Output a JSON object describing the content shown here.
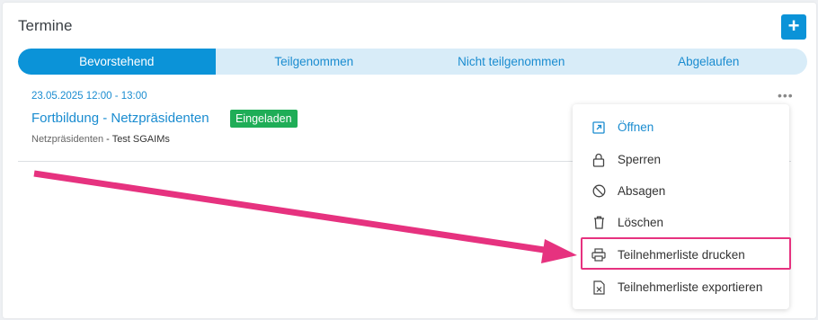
{
  "panel": {
    "title": "Termine",
    "add_label": "+"
  },
  "tabs": [
    {
      "label": "Bevorstehend",
      "active": true
    },
    {
      "label": "Teilgenommen",
      "active": false
    },
    {
      "label": "Nicht teilgenommen",
      "active": false
    },
    {
      "label": "Abgelaufen",
      "active": false
    }
  ],
  "event": {
    "datetime": "23.05.2025 12:00 - 13:00",
    "title": "Fortbildung - Netzpräsidenten",
    "status_badge": "Eingeladen",
    "group": "Netzpräsidenten",
    "separator": " - ",
    "course": "Test SGAIMs",
    "more_label": "•••"
  },
  "menu": {
    "items": [
      {
        "label": "Öffnen",
        "icon": "external-link-icon"
      },
      {
        "label": "Sperren",
        "icon": "lock-icon"
      },
      {
        "label": "Absagen",
        "icon": "cancel-icon"
      },
      {
        "label": "Löschen",
        "icon": "trash-icon"
      },
      {
        "label": "Teilnehmerliste drucken",
        "icon": "printer-icon"
      },
      {
        "label": "Teilnehmerliste exportieren",
        "icon": "excel-file-icon"
      }
    ]
  },
  "colors": {
    "accent": "#0b93d8",
    "badge": "#1fad57",
    "annotation": "#e6327f"
  }
}
